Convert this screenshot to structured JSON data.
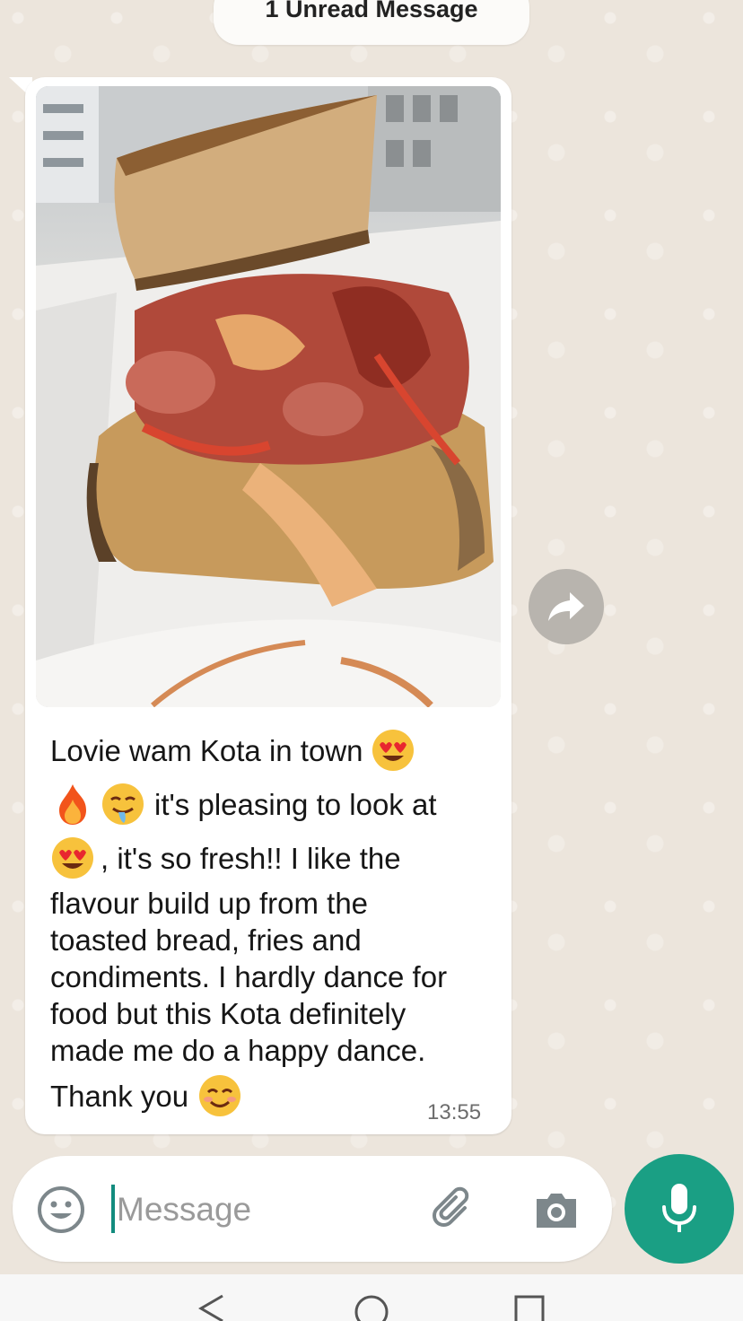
{
  "unread_banner": "1 Unread Message",
  "message": {
    "lines": [
      {
        "text": "Lovie wam Kota in town",
        "emoji_after": "heart-eyes"
      },
      {
        "emoji_before": [
          "fire",
          "drooling"
        ],
        "text": "it's pleasing to look at"
      },
      {
        "emoji_before": [
          "heart-eyes"
        ],
        "text": ", it's so fresh!! I like the"
      },
      {
        "text": "flavour build up from the"
      },
      {
        "text": "toasted bread, fries and"
      },
      {
        "text": "condiments. I hardly dance for"
      },
      {
        "text": "food but this Kota definitely"
      },
      {
        "text": "made me do a happy dance."
      },
      {
        "text": "Thank you",
        "emoji_after": "smiling"
      }
    ],
    "time": "13:55"
  },
  "composer": {
    "placeholder": "Message"
  },
  "icons": {
    "forward": "forward-arrow-icon",
    "emoji": "emoji-icon",
    "attach": "paperclip-icon",
    "camera": "camera-icon",
    "mic": "microphone-icon"
  },
  "colors": {
    "accent": "#1a9f84",
    "bubble": "#ffffff",
    "wallpaper": "#ece5dc"
  }
}
